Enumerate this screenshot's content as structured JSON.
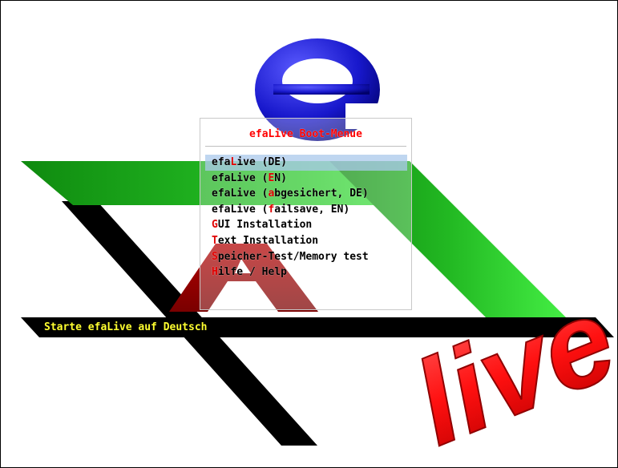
{
  "logo": {
    "wordmark": "live"
  },
  "menu": {
    "title": "efaLive Boot-Menue",
    "items": [
      {
        "pre": "efa",
        "key": "L",
        "post": "ive (DE)",
        "selected": true
      },
      {
        "pre": "efaLive (",
        "key": "E",
        "post": "N)",
        "selected": false
      },
      {
        "pre": "efaLive (",
        "key": "a",
        "post": "bgesichert, DE)",
        "selected": false
      },
      {
        "pre": "efaLive (",
        "key": "f",
        "post": "ailsave, EN)",
        "selected": false
      },
      {
        "pre": "",
        "key": "G",
        "post": "UI Installation",
        "selected": false
      },
      {
        "pre": "",
        "key": "T",
        "post": "ext Installation",
        "selected": false
      },
      {
        "pre": "",
        "key": "S",
        "post": "peicher-Test/Memory test",
        "selected": false
      },
      {
        "pre": "",
        "key": "H",
        "post": "ilfe / Help",
        "selected": false
      }
    ]
  },
  "status": {
    "text": "Starte efaLive auf Deutsch"
  },
  "colors": {
    "menu_title": "#ff0000",
    "hotkey": "#e00000",
    "status_text": "#ffff30",
    "selection": "#aac8eb",
    "green_bar": "#22bb22",
    "black_bar": "#000000",
    "dark_red_a": "#990000",
    "blue_e": "#1a1acc",
    "red_live": "#ff1111"
  }
}
